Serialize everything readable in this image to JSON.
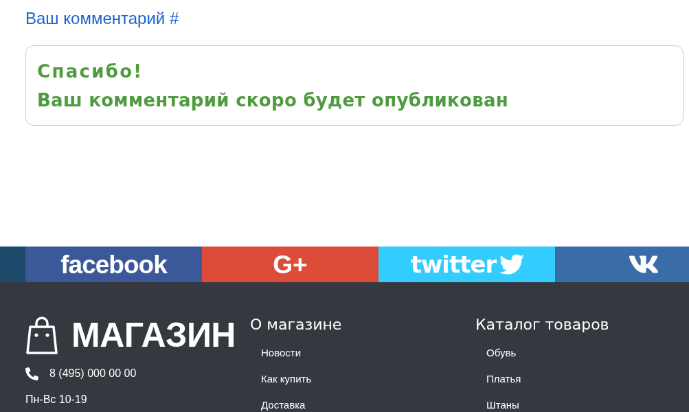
{
  "comment_section": {
    "heading": "Ваш комментарий #",
    "message": {
      "title": "Спасибо!",
      "text": "Ваш комментарий скоро будет опубликован"
    }
  },
  "social_bar": [
    {
      "kind": "facebook",
      "label": "facebook"
    },
    {
      "kind": "googleplus",
      "label": "G+"
    },
    {
      "kind": "twitter",
      "label": "twitter"
    },
    {
      "kind": "vk"
    }
  ],
  "footer": {
    "logo": {
      "text": "МАГАЗИН"
    },
    "phone": "8 (495) 000 00 00",
    "hours": "Пн-Вс 10-19",
    "columns": [
      {
        "title": "О магазине",
        "links": [
          "Новости",
          "Как купить",
          "Доставка"
        ]
      },
      {
        "title": "Каталог товаров",
        "links": [
          "Обувь",
          "Платья",
          "Штаны"
        ]
      }
    ]
  }
}
